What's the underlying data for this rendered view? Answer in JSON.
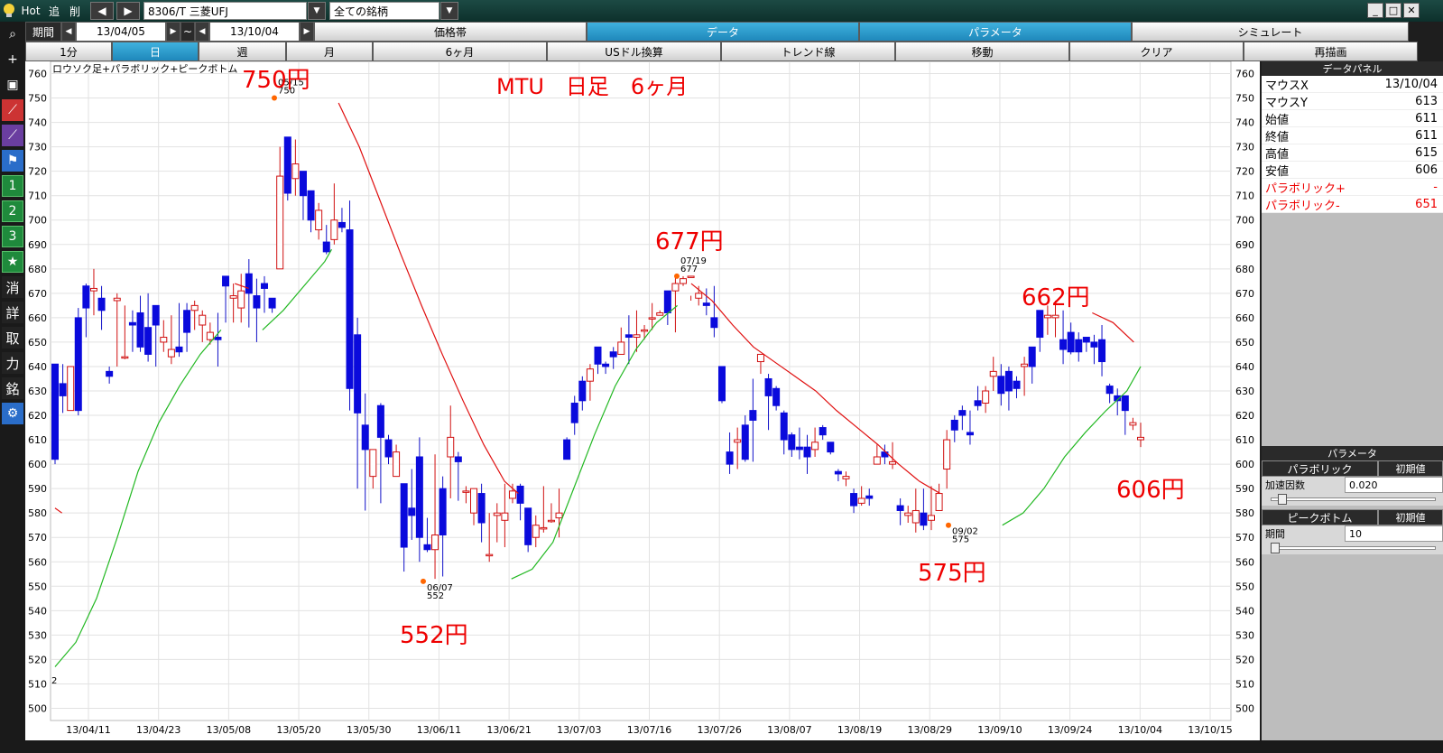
{
  "topbar": {
    "hot": "Hot",
    "prev": "追",
    "del": "削",
    "symbol": "8306/T 三菱UFJ",
    "universe": "全ての銘柄"
  },
  "period": {
    "label": "期間",
    "start": "13/04/05",
    "sep": "~",
    "end": "13/10/04"
  },
  "mainTabs": [
    "価格帯",
    "データ",
    "パラメータ",
    "シミュレート"
  ],
  "row2": [
    "1分",
    "日",
    "週",
    "月",
    "6ヶ月",
    "USドル換算",
    "トレンド線",
    "移動",
    "クリア",
    "再描画"
  ],
  "left_buttons": [
    "消",
    "詳",
    "取",
    "力",
    "銘"
  ],
  "left_numbers": [
    "1",
    "2",
    "3"
  ],
  "chart_data": {
    "type": "candlestick",
    "title": "MTU　日足　6ヶ月",
    "legend": "ロウソク足+パラボリック+ピークボトム",
    "ylim": [
      495,
      765
    ],
    "yticks": [
      500,
      510,
      520,
      530,
      540,
      550,
      560,
      570,
      580,
      590,
      600,
      610,
      620,
      630,
      640,
      650,
      660,
      670,
      680,
      690,
      700,
      710,
      720,
      730,
      740,
      750,
      760
    ],
    "xticks": [
      "13/04/11",
      "13/04/23",
      "13/05/08",
      "13/05/20",
      "13/05/30",
      "13/06/11",
      "13/06/21",
      "13/07/03",
      "13/07/16",
      "13/07/26",
      "13/08/07",
      "13/08/19",
      "13/08/29",
      "13/09/10",
      "13/09/24",
      "13/10/04",
      "13/10/15"
    ],
    "bottom_left_number": "2",
    "candles": [
      [
        641,
        602,
        641,
        600
      ],
      [
        633,
        628,
        641,
        621
      ],
      [
        622,
        640,
        640,
        622
      ],
      [
        660,
        622,
        664,
        620
      ],
      [
        673,
        664,
        674,
        652
      ],
      [
        671,
        672,
        680,
        661
      ],
      [
        668,
        663,
        673,
        655
      ],
      [
        638,
        636,
        640,
        633
      ],
      [
        667,
        668,
        670,
        640
      ],
      [
        644,
        644,
        665,
        643
      ],
      [
        658,
        657,
        663,
        646
      ],
      [
        662,
        648,
        669,
        646
      ],
      [
        656,
        645,
        670,
        642
      ],
      [
        665,
        657,
        662,
        640
      ],
      [
        650,
        652,
        659,
        646
      ],
      [
        644,
        647,
        661,
        641
      ],
      [
        648,
        646,
        666,
        644
      ],
      [
        663,
        654,
        666,
        646
      ],
      [
        663,
        665,
        667,
        655
      ],
      [
        657,
        661,
        663,
        650
      ],
      [
        651,
        654,
        658,
        649
      ],
      [
        652,
        651,
        662,
        640
      ],
      [
        677,
        673,
        677,
        658
      ],
      [
        668,
        669,
        674,
        658
      ],
      [
        664,
        671,
        678,
        658
      ],
      [
        678,
        670,
        684,
        656
      ],
      [
        669,
        664,
        676,
        650
      ],
      [
        674,
        672,
        677,
        662
      ],
      [
        668,
        664,
        668,
        662
      ],
      [
        680,
        718,
        730,
        680
      ],
      [
        734,
        711,
        734,
        708
      ],
      [
        717,
        723,
        733,
        710
      ],
      [
        720,
        710,
        720,
        700
      ],
      [
        712,
        700,
        712,
        695
      ],
      [
        696,
        704,
        707,
        692
      ],
      [
        691,
        687,
        698,
        686
      ],
      [
        692,
        700,
        715,
        690
      ],
      [
        699,
        697,
        705,
        695
      ],
      [
        696,
        631,
        708,
        622
      ],
      [
        653,
        621,
        660,
        590
      ],
      [
        616,
        606,
        629,
        581
      ],
      [
        595,
        606,
        604,
        590
      ],
      [
        624,
        611,
        625,
        584
      ],
      [
        610,
        603,
        612,
        600
      ],
      [
        595,
        605,
        608,
        601
      ],
      [
        592,
        566,
        583,
        556
      ],
      [
        582,
        579,
        598,
        569
      ],
      [
        603,
        570,
        611,
        560
      ],
      [
        567,
        565,
        578,
        564
      ],
      [
        565,
        571,
        604,
        553
      ],
      [
        590,
        571,
        595,
        554
      ],
      [
        603,
        611,
        624,
        586
      ],
      [
        603,
        601,
        605,
        585
      ],
      [
        589,
        589,
        591,
        584
      ],
      [
        580,
        590,
        590,
        575
      ],
      [
        588,
        576,
        592,
        568
      ],
      [
        563,
        563,
        580,
        560
      ],
      [
        579,
        580,
        584,
        568
      ],
      [
        577,
        580,
        592,
        566
      ],
      [
        586,
        589,
        592,
        584
      ],
      [
        591,
        584,
        592,
        577
      ],
      [
        582,
        567,
        582,
        564
      ],
      [
        570,
        575,
        579,
        566
      ],
      [
        574,
        574,
        591,
        572
      ],
      [
        577,
        577,
        584,
        576
      ],
      [
        578,
        580,
        590,
        570
      ],
      [
        610,
        602,
        611,
        604
      ],
      [
        625,
        617,
        628,
        612
      ],
      [
        634,
        626,
        636,
        622
      ],
      [
        634,
        639,
        641,
        626
      ],
      [
        648,
        641,
        641,
        637
      ],
      [
        641,
        640,
        642,
        637
      ],
      [
        646,
        644,
        648,
        639
      ],
      [
        645,
        650,
        656,
        645
      ],
      [
        653,
        652,
        661,
        641
      ],
      [
        652,
        653,
        663,
        646
      ],
      [
        655,
        655,
        657,
        651
      ],
      [
        660,
        660,
        666,
        655
      ],
      [
        661,
        662,
        663,
        661
      ],
      [
        671,
        662,
        671,
        657
      ],
      [
        671,
        674,
        677,
        654
      ],
      [
        674,
        676,
        677,
        673
      ],
      [
        677,
        677,
        667,
        669
      ],
      [
        668,
        670,
        673,
        665
      ],
      [
        666,
        665,
        672,
        661
      ],
      [
        660,
        656,
        673,
        652
      ],
      [
        640,
        626,
        640,
        625
      ],
      [
        605,
        600,
        613,
        596
      ],
      [
        609,
        610,
        615,
        598
      ],
      [
        616,
        602,
        620,
        601
      ],
      [
        622,
        618,
        635,
        601
      ],
      [
        642,
        645,
        645,
        637
      ],
      [
        635,
        628,
        637,
        614
      ],
      [
        631,
        624,
        632,
        622
      ],
      [
        621,
        610,
        622,
        604
      ],
      [
        612,
        606,
        613,
        603
      ],
      [
        607,
        606,
        615,
        602
      ],
      [
        607,
        603,
        612,
        596
      ],
      [
        606,
        609,
        615,
        603
      ],
      [
        615,
        612,
        616,
        610
      ],
      [
        609,
        605,
        608,
        604
      ],
      [
        597,
        596,
        598,
        593
      ],
      [
        594,
        595,
        597,
        591
      ],
      [
        588,
        583,
        590,
        580
      ],
      [
        584,
        586,
        591,
        583
      ],
      [
        587,
        586,
        590,
        583
      ],
      [
        600,
        603,
        608,
        601
      ],
      [
        605,
        603,
        608,
        600
      ],
      [
        600,
        601,
        609,
        598
      ],
      [
        583,
        581,
        586,
        575
      ],
      [
        579,
        580,
        583,
        576
      ],
      [
        576,
        581,
        590,
        572
      ],
      [
        580,
        575,
        590,
        573
      ],
      [
        577,
        579,
        591,
        573
      ],
      [
        581,
        588,
        592,
        587
      ],
      [
        598,
        610,
        614,
        590
      ],
      [
        618,
        614,
        620,
        609
      ],
      [
        622,
        620,
        624,
        614
      ],
      [
        613,
        612,
        622,
        608
      ],
      [
        626,
        624,
        632,
        622
      ],
      [
        625,
        630,
        632,
        621
      ],
      [
        636,
        638,
        644,
        630
      ],
      [
        636,
        629,
        641,
        624
      ],
      [
        638,
        630,
        640,
        622
      ],
      [
        634,
        631,
        636,
        627
      ],
      [
        640,
        641,
        644,
        628
      ],
      [
        648,
        640,
        648,
        633
      ],
      [
        663,
        652,
        663,
        646
      ],
      [
        660,
        661,
        665,
        653
      ],
      [
        660,
        661,
        667,
        652
      ],
      [
        651,
        647,
        663,
        641
      ],
      [
        654,
        646,
        658,
        645
      ],
      [
        651,
        646,
        654,
        642
      ],
      [
        652,
        650,
        652,
        646
      ],
      [
        650,
        648,
        653,
        641
      ],
      [
        651,
        642,
        657,
        636
      ],
      [
        632,
        629,
        633,
        625
      ],
      [
        628,
        626,
        631,
        620
      ],
      [
        628,
        622,
        625,
        612
      ],
      [
        616,
        617,
        619,
        614
      ],
      [
        610,
        611,
        617,
        607
      ]
    ],
    "par_plus": [
      [
        61,
        578
      ],
      [
        71,
        545
      ],
      [
        82,
        521
      ],
      [
        92,
        506
      ],
      [
        104,
        478
      ],
      [
        116,
        452
      ],
      [
        128,
        425
      ],
      [
        140,
        400
      ],
      [
        152,
        375
      ],
      [
        164,
        350
      ],
      [
        176,
        326
      ],
      [
        188,
        303
      ],
      [
        200,
        284
      ],
      [
        212,
        263
      ],
      [
        224,
        241
      ],
      [
        236,
        222
      ],
      [
        248,
        200
      ],
      [
        259,
        182
      ],
      [
        271,
        164
      ],
      [
        283,
        150
      ],
      [
        295,
        136
      ],
      [
        307,
        122
      ],
      [
        319,
        110
      ],
      [
        331,
        99
      ],
      [
        343,
        90
      ],
      [
        355,
        80
      ],
      [
        367,
        72
      ],
      [
        380,
        65
      ],
      [
        392,
        58
      ],
      [
        404,
        52
      ],
      [
        416,
        47
      ],
      [
        428,
        41
      ],
      [
        440,
        36
      ],
      [
        452,
        30
      ]
    ],
    "par_minus": [
      [
        380,
        133
      ],
      [
        393,
        156
      ],
      [
        405,
        180
      ],
      [
        418,
        205
      ],
      [
        430,
        232
      ],
      [
        442,
        260
      ],
      [
        454,
        289
      ],
      [
        466,
        316
      ],
      [
        478,
        340
      ],
      [
        490,
        360
      ],
      [
        502,
        381
      ],
      [
        514,
        398
      ],
      [
        526,
        412
      ],
      [
        538,
        424
      ],
      [
        550,
        433
      ],
      [
        562,
        441
      ]
    ],
    "peaks": [
      {
        "x": 304,
        "y": 750,
        "date": "05/15",
        "val": "750",
        "label": "750円",
        "lx": 268,
        "ly": 97,
        "type": "peak"
      },
      {
        "x": 469,
        "y": 552,
        "date": "06/07",
        "val": "552",
        "label": "552円",
        "lx": 443,
        "ly": 712,
        "type": "bottom"
      },
      {
        "x": 750,
        "y": 677,
        "date": "07/19",
        "val": "677",
        "label": "677円",
        "lx": 726,
        "ly": 276,
        "type": "peak"
      },
      {
        "x": 1051,
        "y": 575,
        "date": "09/02",
        "val": "575",
        "label": "575円",
        "lx": 1017,
        "ly": 643,
        "type": "bottom"
      },
      {
        "x": 1174,
        "y": 662,
        "date": "",
        "val": "",
        "label": "662円",
        "lx": 1132,
        "ly": 338,
        "type": "peak"
      },
      {
        "x": 1264,
        "y": 606,
        "date": "",
        "val": "",
        "label": "606円",
        "lx": 1237,
        "ly": 551,
        "type": "bottom"
      }
    ]
  },
  "dataPanel": {
    "title": "データパネル",
    "rows": [
      [
        "マウスX",
        "13/10/04"
      ],
      [
        "マウスY",
        "613"
      ],
      [
        "始値",
        "611"
      ],
      [
        "終値",
        "611"
      ],
      [
        "高値",
        "615"
      ],
      [
        "安値",
        "606"
      ]
    ],
    "redRows": [
      [
        "パラボリック+",
        "-"
      ],
      [
        "パラボリック-",
        "651"
      ]
    ]
  },
  "paramPanel": {
    "title": "パラメータ",
    "parabolic": "パラボリック",
    "init1": "初期値",
    "accel": "加速因数",
    "accelVal": "0.020",
    "peak": "ピークボトム",
    "init2": "初期値",
    "period": "期間",
    "periodVal": "10"
  }
}
